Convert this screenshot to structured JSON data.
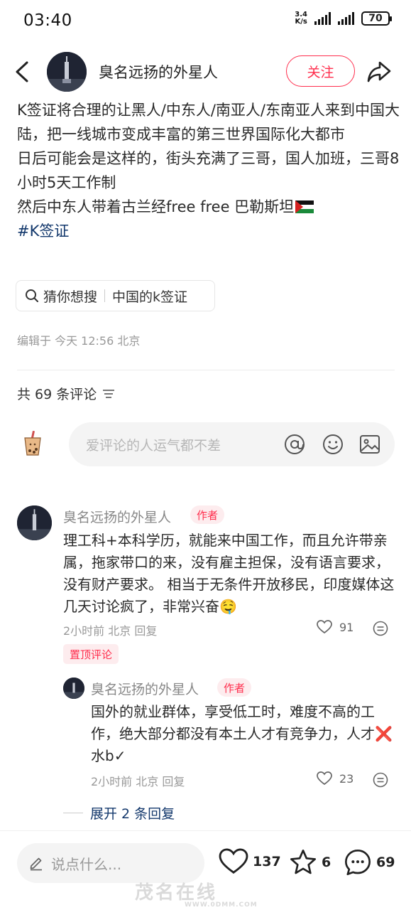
{
  "status_bar": {
    "time": "03:40",
    "speed_value": "3.4",
    "speed_unit": "K/s",
    "battery": "70"
  },
  "header": {
    "author": "臭名远扬的外星人",
    "follow_label": "关注"
  },
  "post": {
    "lines": [
      "K签证将合理的让黑人/中东人/南亚人/东南亚人来到中国大陆，把一线城市变成丰富的第三世界国际化大都市",
      "日后可能会是这样的，街头充满了三哥，国人加班，三哥8小时5天工作制",
      "然后中东人带着古兰经free free 巴勒斯坦"
    ],
    "hashtag": "#K签证"
  },
  "search_chip": {
    "prefix": "猜你想搜",
    "query": "中国的k签证"
  },
  "edit_meta": "编辑于 今天 12:56 北京",
  "comments_header": {
    "count_label": "共 69 条评论"
  },
  "comment_input": {
    "placeholder": "爱评论的人运气都不差"
  },
  "comments": [
    {
      "author": "臭名远扬的外星人",
      "badge": "作者",
      "text": "理工科+本科学历，就能来中国工作，而且允许带亲属，拖家带口的来，没有雇主担保，没有语言要求，没有财产要求。 相当于无条件开放移民，印度媒体这几天讨论疯了，非常兴奋🤤",
      "meta": "2小时前 北京 回复",
      "likes": "91",
      "pinned_label": "置顶评论"
    }
  ],
  "reply": {
    "author": "臭名远扬的外星人",
    "badge": "作者",
    "text": "国外的就业群体，享受低工时，难度不高的工作，绝大部分都没有本土人才有竞争力，人才❌水b✓",
    "meta": "2小时前 北京 回复",
    "likes": "23"
  },
  "expand_label": "展开 2 条回复",
  "bottom_bar": {
    "say_placeholder": "说点什么...",
    "likes": "137",
    "stars": "6",
    "comments": "69"
  },
  "watermark": {
    "text": "茂名在线",
    "url": "WWW.0DMM.COM"
  },
  "colors": {
    "accent": "#ff2e4d",
    "hashtag": "#13386c",
    "meta": "#999999"
  }
}
